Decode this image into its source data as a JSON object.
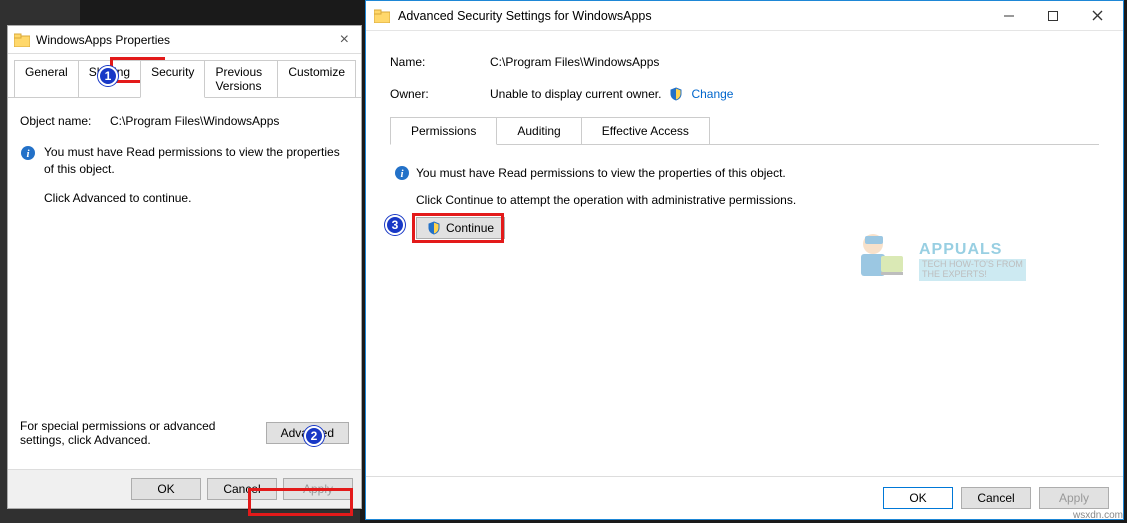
{
  "props_dialog": {
    "title": "WindowsApps Properties",
    "tabs": {
      "general": "General",
      "sharing": "Sharing",
      "security": "Security",
      "previous_versions": "Previous Versions",
      "customize": "Customize"
    },
    "object_name_label": "Object name:",
    "object_name_value": "C:\\Program Files\\WindowsApps",
    "msg1": "You must have Read permissions to view the properties of this object.",
    "msg2": "Click Advanced to continue.",
    "special_text": "For special permissions or advanced settings, click Advanced.",
    "advanced_btn": "Advanced",
    "ok": "OK",
    "cancel": "Cancel",
    "apply": "Apply"
  },
  "adv_dialog": {
    "title": "Advanced Security Settings for WindowsApps",
    "name_label": "Name:",
    "name_value": "C:\\Program Files\\WindowsApps",
    "owner_label": "Owner:",
    "owner_value": "Unable to display current owner.",
    "change_link": "Change",
    "tabs": {
      "permissions": "Permissions",
      "auditing": "Auditing",
      "effective": "Effective Access"
    },
    "line1": "You must have Read permissions to view the properties of this object.",
    "line2": "Click Continue to attempt the operation with administrative permissions.",
    "continue_btn": "Continue",
    "ok": "OK",
    "cancel": "Cancel",
    "apply": "Apply"
  },
  "badges": {
    "b1": "1",
    "b2": "2",
    "b3": "3"
  },
  "watermark": {
    "title": "APPUALS",
    "sub1": "TECH HOW-TO'S FROM",
    "sub2": "THE EXPERTS!"
  },
  "attribution": "wsxdn.com"
}
